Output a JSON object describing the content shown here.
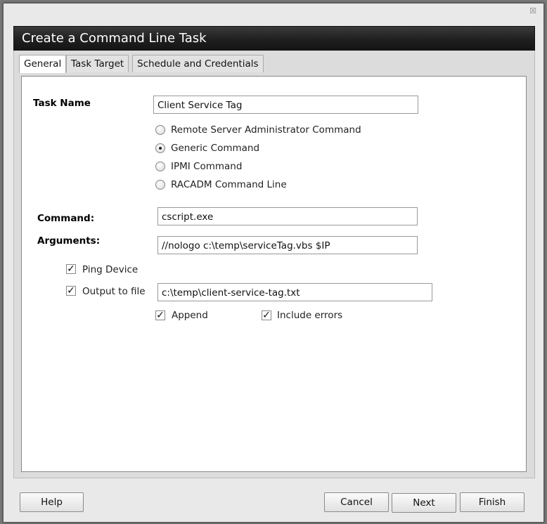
{
  "dialog": {
    "title": "Create a Command Line Task",
    "close_glyph": "☒"
  },
  "tabs": [
    {
      "label": "General",
      "active": true
    },
    {
      "label": "Task Target",
      "active": false
    },
    {
      "label": "Schedule and Credentials",
      "active": false
    }
  ],
  "form": {
    "task_name_label": "Task Name",
    "task_name_value": "Client Service Tag",
    "command_types": [
      {
        "label": "Remote Server Administrator Command",
        "selected": false
      },
      {
        "label": "Generic Command",
        "selected": true
      },
      {
        "label": "IPMI Command",
        "selected": false
      },
      {
        "label": "RACADM Command Line",
        "selected": false
      }
    ],
    "command_label": "Command:",
    "command_value": "cscript.exe",
    "arguments_label": "Arguments:",
    "arguments_value": "//nologo c:\\temp\\serviceTag.vbs $IP",
    "ping_device_label": "Ping Device",
    "ping_device_checked": true,
    "output_to_file_label": "Output to file",
    "output_to_file_checked": true,
    "output_file_value": "c:\\temp\\client-service-tag.txt",
    "append_label": "Append",
    "append_checked": true,
    "include_errors_label": "Include errors",
    "include_errors_checked": true
  },
  "footer": {
    "help_label": "Help",
    "cancel_label": "Cancel",
    "next_label": "Next",
    "finish_label": "Finish"
  }
}
